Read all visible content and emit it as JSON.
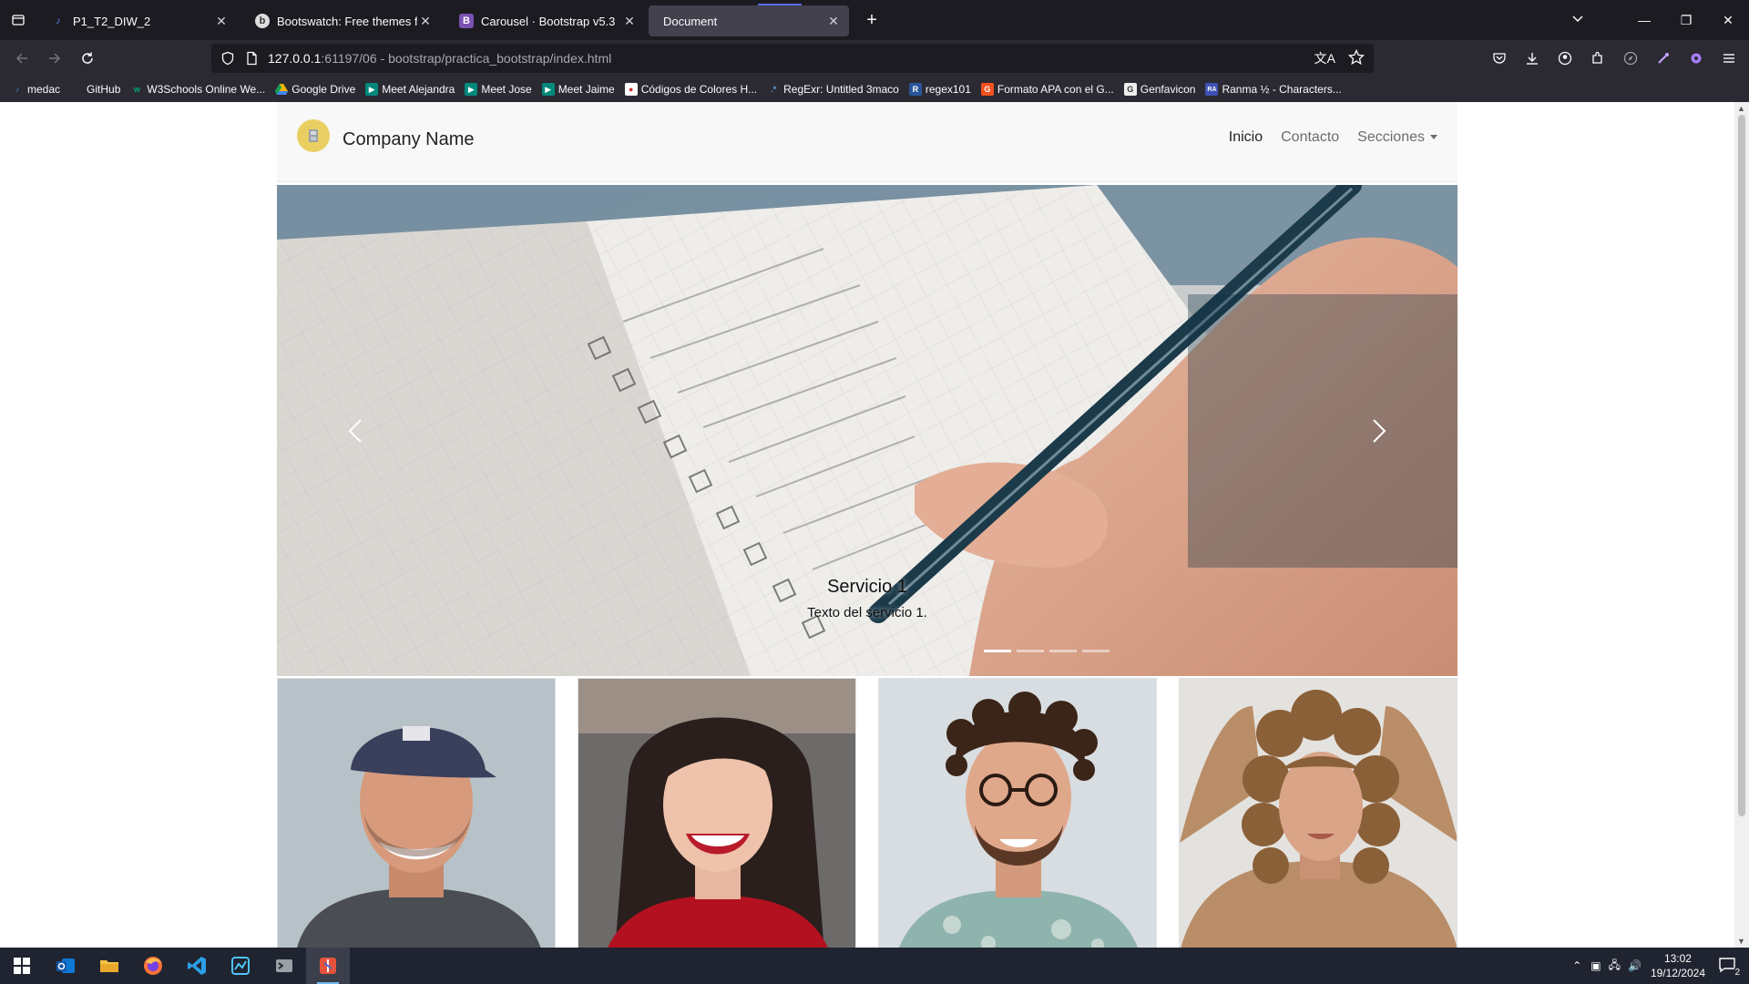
{
  "browser": {
    "tabs": [
      {
        "title": "P1_T2_DIW_2",
        "active": false,
        "favicon": "file-icon"
      },
      {
        "title": "Bootswatch: Free themes for Bo",
        "active": false,
        "favicon": "bootswatch-icon"
      },
      {
        "title": "Carousel · Bootstrap v5.3",
        "active": false,
        "favicon": "bootstrap-icon"
      },
      {
        "title": "Document",
        "active": true,
        "favicon": ""
      }
    ],
    "url": {
      "host": "127.0.0.1",
      "rest": ":61197/06 - bootstrap/practica_bootstrap/index.html"
    },
    "bookmarks": [
      {
        "label": "medac",
        "icon": "medac-icon",
        "color": "#4a7bd4"
      },
      {
        "label": "GitHub",
        "icon": "",
        "color": ""
      },
      {
        "label": "W3Schools Online We...",
        "icon": "w3schools-icon",
        "color": "#04aa6d"
      },
      {
        "label": "Google Drive",
        "icon": "drive-icon",
        "color": "#f4b400"
      },
      {
        "label": "Meet Alejandra",
        "icon": "meet-icon",
        "color": "#00897b"
      },
      {
        "label": "Meet Jose",
        "icon": "meet-icon",
        "color": "#00897b"
      },
      {
        "label": "Meet Jaime",
        "icon": "meet-icon",
        "color": "#00897b"
      },
      {
        "label": "Códigos de Colores H...",
        "icon": "colors-icon",
        "color": "#d32f2f"
      },
      {
        "label": "RegExr: Untitled 3maco",
        "icon": "regexr-icon",
        "color": "#6aa1d8"
      },
      {
        "label": "regex101",
        "icon": "regex101-icon",
        "color": "#2a5599"
      },
      {
        "label": "Formato APA con el G...",
        "icon": "apa-icon",
        "color": "#f4511e"
      },
      {
        "label": "Genfavicon",
        "icon": "genfavicon-icon",
        "color": "#cccccc"
      },
      {
        "label": "Ranma ½ - Characters...",
        "icon": "ranma-icon",
        "color": "#3f51b5"
      }
    ]
  },
  "site": {
    "brand": "Company Name",
    "nav": {
      "home": "Inicio",
      "contact": "Contacto",
      "sections": "Secciones"
    },
    "carousel": {
      "caption_title": "Servicio 1",
      "caption_text": "Texto del servicio 1.",
      "slide_count": 4,
      "active_slide": 1
    },
    "team_cards": [
      {
        "name": "man-cap-photo"
      },
      {
        "name": "woman-red-top-photo"
      },
      {
        "name": "man-glasses-photo"
      },
      {
        "name": "woman-curly-hair-photo"
      }
    ]
  },
  "taskbar": {
    "time": "13:02",
    "date": "19/12/2024",
    "notifications": "2"
  },
  "colors": {
    "browser_bg": "#1c1b22",
    "toolbar_bg": "#2b2a33",
    "site_nav_bg": "#f8f8f8",
    "taskbar_bg": "#1f2430"
  }
}
